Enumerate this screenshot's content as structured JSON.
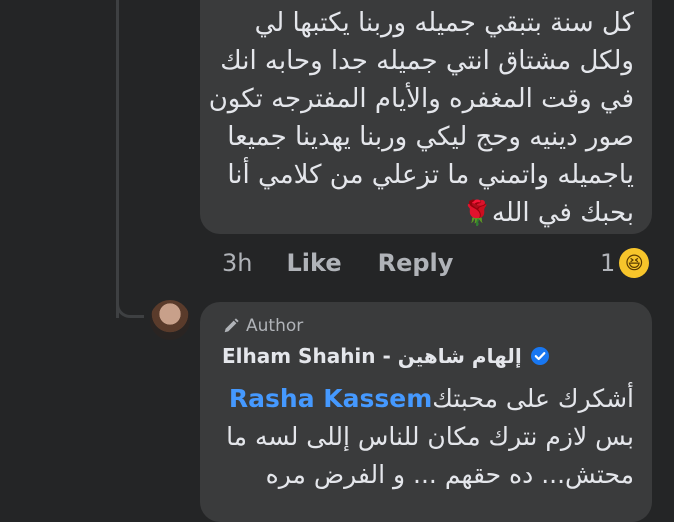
{
  "comment": {
    "lines": [
      "كل سنة بتبقي جميله وربنا يكتبها لي",
      "ولكل مشتاق انتي جميله جدا وحابه انك",
      "في وقت المغفره والأيام المفترجه تكون",
      "صور دينيه وحج ليكي وربنا يهدينا جميعا",
      "ياجميله واتمني ما تزعلي من كلامي أنا",
      "بحبك في الله"
    ],
    "emoji": "🌹",
    "time": "3h",
    "like_label": "Like",
    "reply_label": "Reply",
    "reaction_count": "1",
    "reaction_emoji": "😆"
  },
  "reply": {
    "badge": "Author",
    "author_name": "Elham Shahin - إلهام شاهين",
    "mention": "Rasha Kassem",
    "first_text": "أشكرك على محبتك",
    "lines": [
      "بس لازم نترك مكان للناس إللى لسه ما",
      "محتش... ده حقهم ... و الفرض مره"
    ]
  },
  "colors": {
    "background": "#242526",
    "bubble": "#3a3b3c",
    "mention": "#4599ff",
    "verified": "#1877f2"
  }
}
